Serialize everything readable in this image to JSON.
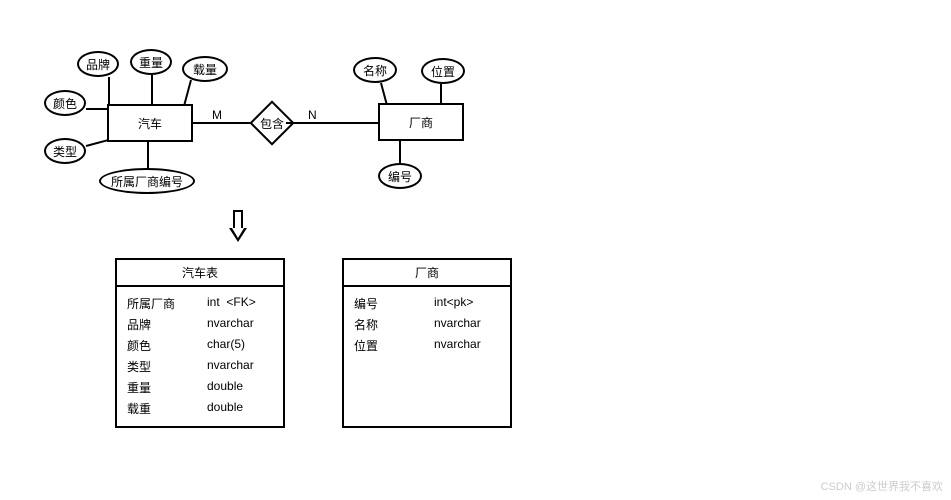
{
  "er": {
    "entities": {
      "car": {
        "label": "汽车"
      },
      "manufacturer": {
        "label": "厂商"
      }
    },
    "relationship": {
      "label": "包含",
      "left_cardinality": "M",
      "right_cardinality": "N"
    },
    "car_attributes": {
      "brand": "品牌",
      "weight": "重量",
      "capacity": "载量",
      "color": "颜色",
      "type": "类型",
      "manufacturer_fk": "所属厂商编号"
    },
    "manufacturer_attributes": {
      "name": "名称",
      "location": "位置",
      "id": "编号"
    }
  },
  "tables": {
    "car": {
      "title": "汽车表",
      "rows": [
        {
          "name": "所属厂商",
          "type": "int",
          "constraint": "<FK>"
        },
        {
          "name": "品牌",
          "type": "nvarchar",
          "constraint": ""
        },
        {
          "name": "颜色",
          "type": "char(5)",
          "constraint": ""
        },
        {
          "name": "类型",
          "type": "nvarchar",
          "constraint": ""
        },
        {
          "name": "重量",
          "type": "double",
          "constraint": ""
        },
        {
          "name": "载重",
          "type": "double",
          "constraint": ""
        }
      ]
    },
    "manufacturer": {
      "title": "厂商",
      "rows": [
        {
          "name": "编号",
          "type": "int<pk>",
          "constraint": ""
        },
        {
          "name": "名称",
          "type": "nvarchar",
          "constraint": ""
        },
        {
          "name": "位置",
          "type": "nvarchar",
          "constraint": ""
        }
      ]
    }
  },
  "watermark": "CSDN @这世界我不喜欢"
}
